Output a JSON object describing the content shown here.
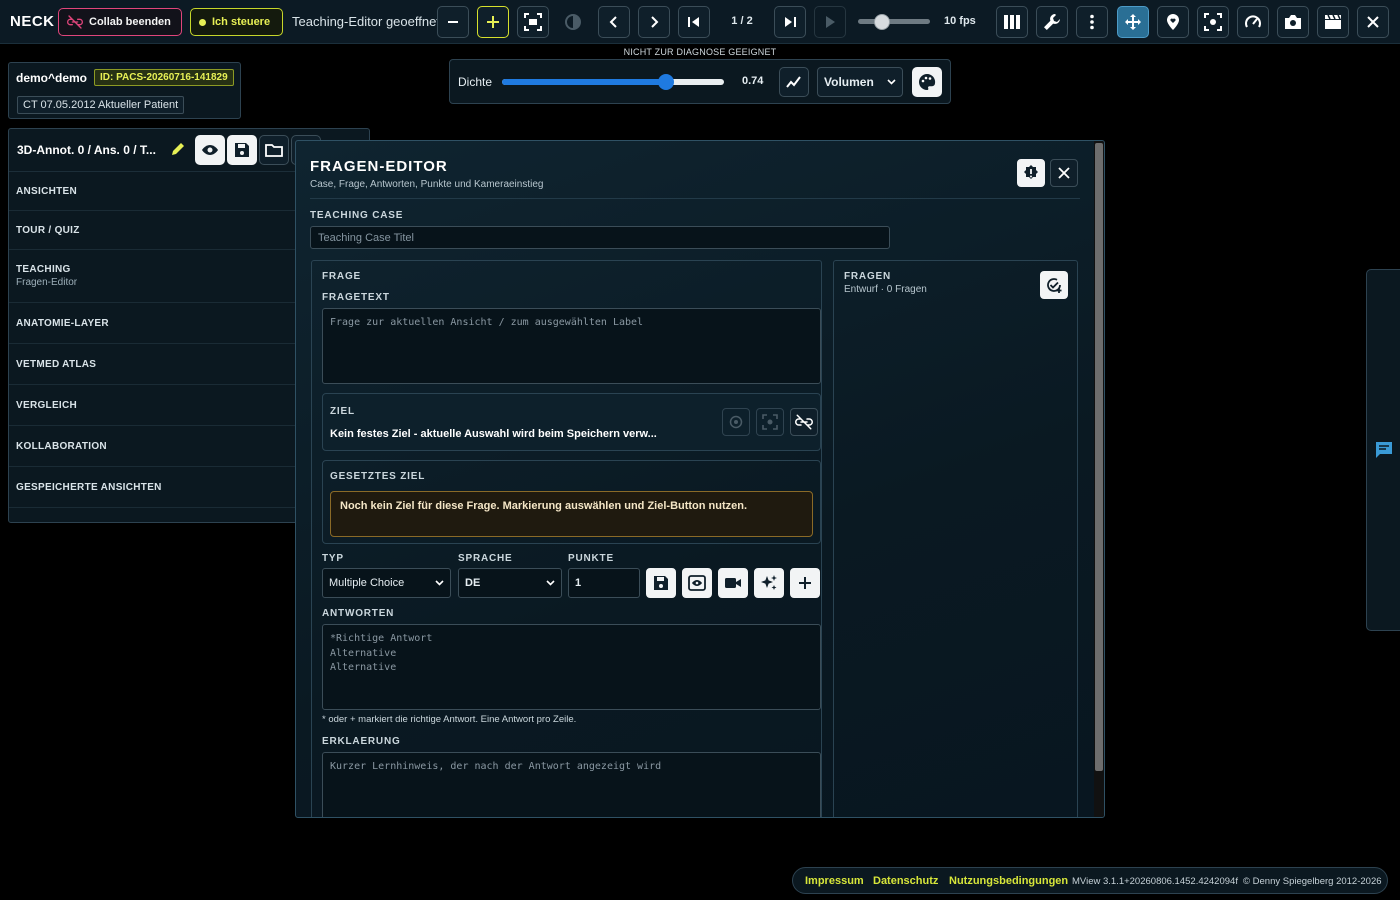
{
  "topbar": {
    "brand": "NECK",
    "collab_label": "Collab beenden",
    "steer_label": "Ich steuere",
    "status": "Teaching-Editor geoeffnet",
    "page": "1 / 2",
    "fps": "10 fps",
    "icons": [
      "minus-icon",
      "plus-icon",
      "fit-screen-icon",
      "contrast-icon",
      "chevron-left-icon",
      "chevron-right-icon",
      "skip-first-icon",
      "skip-last-icon",
      "play-icon",
      "layout-columns-icon",
      "wrench-icon",
      "more-vertical-icon",
      "move-icon",
      "map-pin-heart-icon",
      "focus-icon",
      "speedometer-icon",
      "camera-icon",
      "clapperboard-icon",
      "close-icon"
    ]
  },
  "notice": "NICHT ZUR DIAGNOSE GEEIGNET",
  "density": {
    "label": "Dichte",
    "value": "0.74",
    "value_fraction": 0.74,
    "mode": "Volumen"
  },
  "patient": {
    "name": "demo^demo",
    "id": "ID: PACS-20260716-141829",
    "study": "CT 07.05.2012 Aktueller Patient"
  },
  "sidebar": {
    "title": "3D-Annot. 0 / Ans. 0 / T...",
    "items": [
      {
        "label": "ANSICHTEN",
        "sub": ""
      },
      {
        "label": "TOUR / QUIZ",
        "sub": ""
      },
      {
        "label": "TEACHING",
        "sub": "Fragen-Editor"
      },
      {
        "label": "ANATOMIE-LAYER",
        "sub": ""
      },
      {
        "label": "VETMED ATLAS",
        "sub": ""
      },
      {
        "label": "VERGLEICH",
        "sub": ""
      },
      {
        "label": "KOLLABORATION",
        "sub": ""
      },
      {
        "label": "GESPEICHERTE ANSICHTEN",
        "sub": ""
      }
    ]
  },
  "editor": {
    "title": "FRAGEN-EDITOR",
    "subtitle": "Case, Frage, Antworten, Punkte und Kameraeinstieg",
    "teaching_case_label": "TEACHING CASE",
    "teaching_case_placeholder": "Teaching Case Titel",
    "frage_label": "FRAGE",
    "fragetext_label": "FRAGETEXT",
    "fragetext_placeholder": "Frage zur aktuellen Ansicht / zum ausgewählten Label",
    "ziel_label": "ZIEL",
    "ziel_text": "Kein festes Ziel - aktuelle Auswahl wird beim Speichern verw...",
    "gesetztes_ziel_label": "GESETZTES ZIEL",
    "warning": "Noch kein Ziel für diese Frage. Markierung auswählen und Ziel-Button nutzen.",
    "typ_label": "TYP",
    "typ_value": "Multiple Choice",
    "sprache_label": "SPRACHE",
    "sprache_value": "DE",
    "punkte_label": "PUNKTE",
    "punkte_value": "1",
    "antworten_label": "ANTWORTEN",
    "antworten_placeholder": "*Richtige Antwort\nAlternative\nAlternative",
    "antworten_hint": "* oder + markiert die richtige Antwort. Eine Antwort pro Zeile.",
    "erklaerung_label": "ERKLAERUNG",
    "erklaerung_placeholder": "Kurzer Lernhinweis, der nach der Antwort angezeigt wird",
    "fragen_label": "FRAGEN",
    "fragen_sub": "Entwurf · 0 Fragen"
  },
  "footer": {
    "impressum": "Impressum",
    "datenschutz": "Datenschutz",
    "nutzung": "Nutzungsbedingungen",
    "version": "MView 3.1.1+20260806.1452.4242094f",
    "copyright": "© Denny Spiegelberg 2012-2026"
  },
  "colors": {
    "accent_yellow": "#e7f055",
    "accent_pink": "#e0457b",
    "accent_blue": "#1f7ae0",
    "active_tool": "#2a6f95"
  }
}
